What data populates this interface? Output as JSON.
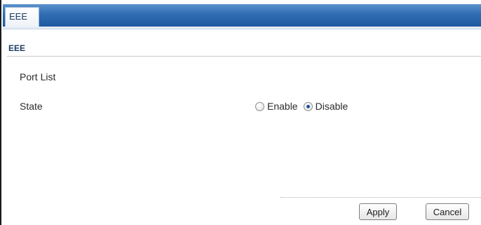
{
  "tabs": [
    {
      "label": "EEE"
    }
  ],
  "section": {
    "title": "EEE"
  },
  "fields": {
    "port_list_label": "Port List",
    "state_label": "State",
    "state_options": [
      {
        "label": "Enable",
        "selected": false
      },
      {
        "label": "Disable",
        "selected": true
      }
    ]
  },
  "buttons": {
    "apply_label": "Apply",
    "cancel_label": "Cancel"
  },
  "colors": {
    "tab_bar": "#2f6cb2",
    "section_title": "#1d3b63"
  }
}
